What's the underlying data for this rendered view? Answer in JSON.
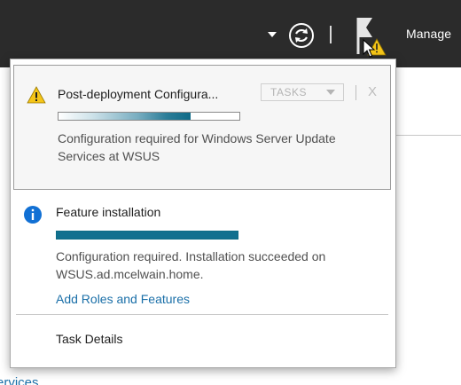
{
  "toolbar": {
    "manage_label": "Manage",
    "icons": [
      "dropdown-arrow-icon",
      "refresh-icon",
      "notification-flag-warning-icon"
    ]
  },
  "background": {
    "partial_link": "Services"
  },
  "notifications": [
    {
      "icon": "warning-icon",
      "title": "Post-deployment Configura...",
      "tasks_label": "TASKS",
      "dismiss_label": "X",
      "progress": 0.73,
      "description": "Configuration required for Windows Server Update Services at WSUS"
    },
    {
      "icon": "info-icon",
      "title": "Feature installation",
      "progress": 1.0,
      "description": "Configuration required. Installation succeeded on WSUS.ad.mcelwain.home.",
      "link": "Add Roles and Features"
    }
  ],
  "footer": {
    "task_details": "Task Details"
  },
  "colors": {
    "topbar": "#2b2b2b",
    "accent": "#11708f",
    "link": "#1a6fa8",
    "warning": "#f5c518",
    "info": "#1170d4"
  }
}
